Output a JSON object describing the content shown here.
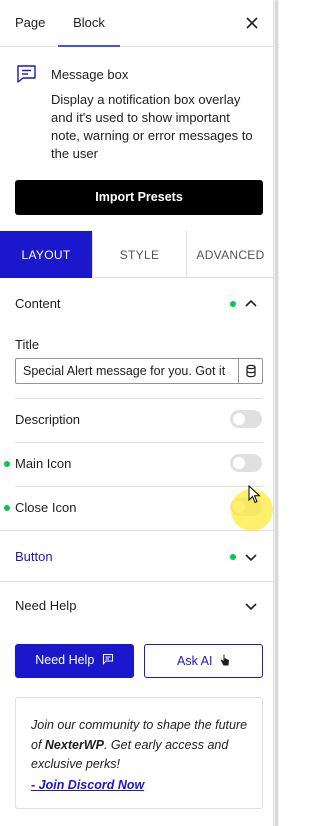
{
  "header": {
    "tabs": [
      {
        "label": "Page",
        "active": false
      },
      {
        "label": "Block",
        "active": true
      }
    ],
    "close_icon": "close-icon"
  },
  "block": {
    "icon": "message-box-icon",
    "title": "Message box",
    "description": "Display a notification box overlay and it's used to show important note, warning or error messages to the user"
  },
  "import_presets_label": "Import Presets",
  "section_tabs": [
    {
      "label": "LAYOUT",
      "active": true
    },
    {
      "label": "STYLE",
      "active": false
    },
    {
      "label": "ADVANCED",
      "active": false
    }
  ],
  "content": {
    "heading": "Content",
    "title_label": "Title",
    "title_value": "Special Alert message for you. Got it",
    "toggles": [
      {
        "label": "Description",
        "checked": false,
        "has_dot": false
      },
      {
        "label": "Main Icon",
        "checked": false,
        "has_dot": true
      },
      {
        "label": "Close Icon",
        "checked": false,
        "has_dot": true
      }
    ]
  },
  "button_section": {
    "label": "Button"
  },
  "need_help": {
    "heading": "Need Help",
    "primary_label": "Need Help",
    "secondary_label": "Ask AI"
  },
  "community": {
    "line1": "Join our community to shape the future of ",
    "brand": "NexterWP",
    "line2": ". Get early access and exclusive perks!",
    "link": "- Join Discord Now"
  },
  "colors": {
    "primary": "#1a17cc",
    "status_dot": "#00c853",
    "import_bg": "#000000"
  }
}
